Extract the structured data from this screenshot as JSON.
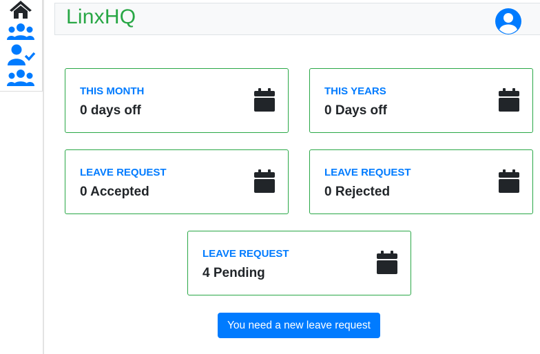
{
  "colors": {
    "brand": "#28a745",
    "accent": "#007bff",
    "text": "#212529",
    "card_border": "#28a745"
  },
  "sidebar": {
    "items": [
      {
        "icon": "home-icon"
      },
      {
        "icon": "users-icon"
      },
      {
        "icon": "user-check-icon"
      },
      {
        "icon": "users-icon"
      }
    ]
  },
  "header": {
    "brand": "LinxHQ",
    "avatar_icon": "user-circle-icon"
  },
  "cards": [
    {
      "title": "THIS MONTH",
      "value": "0 days off",
      "icon": "calendar-icon"
    },
    {
      "title": "THIS YEARS",
      "value": "0 Days off",
      "icon": "calendar-icon"
    },
    {
      "title": "LEAVE REQUEST",
      "value": "0 Accepted",
      "icon": "calendar-icon"
    },
    {
      "title": "LEAVE REQUEST",
      "value": "0 Rejected",
      "icon": "calendar-icon"
    },
    {
      "title": "LEAVE REQUEST",
      "value": "4 Pending",
      "icon": "calendar-icon"
    }
  ],
  "actions": {
    "new_request_label": "You need a new leave request"
  }
}
